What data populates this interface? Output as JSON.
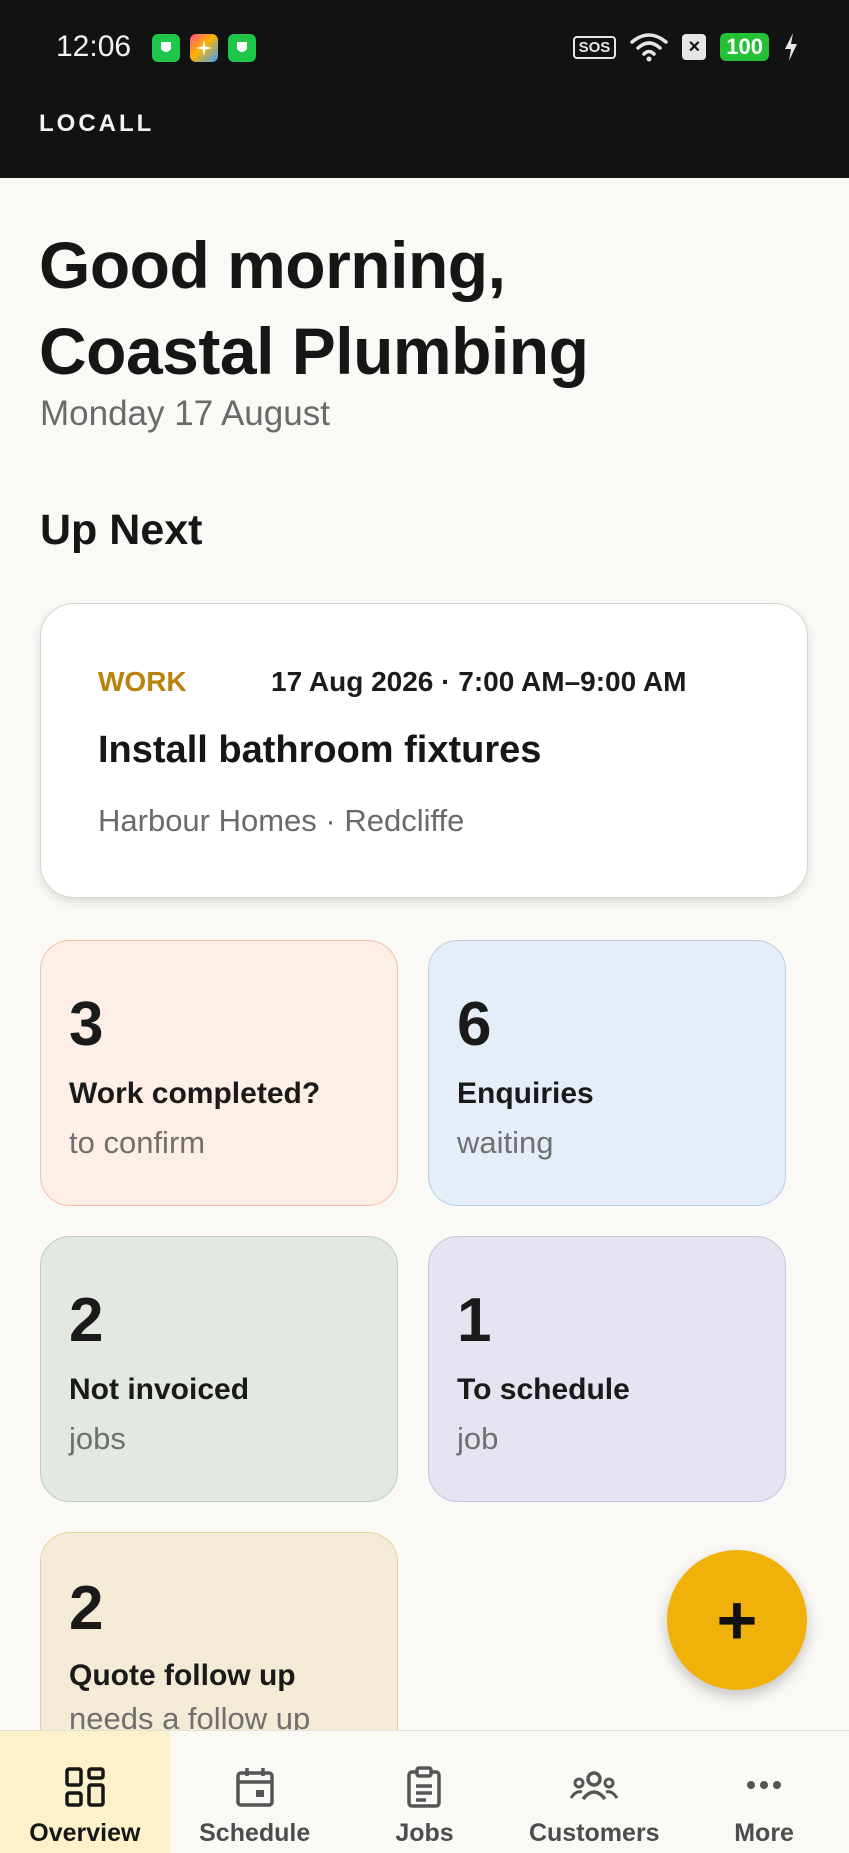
{
  "status_bar": {
    "time": "12:06",
    "sos": "SOS",
    "battery": "100"
  },
  "app": {
    "brand": "LOCALL"
  },
  "header": {
    "greeting_line1": "Good morning,",
    "greeting_line2": "Coastal Plumbing",
    "date": "Monday 17 August"
  },
  "up_next": {
    "section_title": "Up Next",
    "card": {
      "type": "WORK",
      "when": "17 Aug 2026 · 7:00 AM–9:00 AM",
      "title": "Install bathroom fixtures",
      "meta": "Harbour Homes · Redcliffe"
    }
  },
  "stats": [
    {
      "count": "3",
      "label": "Work completed?",
      "sub": "to confirm",
      "bg": "#fdeee6",
      "border": "#f2bfa8"
    },
    {
      "count": "6",
      "label": "Enquiries",
      "sub": "waiting",
      "bg": "#e5eef8",
      "border": "#b8cfe8"
    },
    {
      "count": "2",
      "label": "Not invoiced",
      "sub": "jobs",
      "bg": "#e3e8e1",
      "border": "#bfcfbd"
    },
    {
      "count": "1",
      "label": "To schedule",
      "sub": "job",
      "bg": "#e7e3f0",
      "border": "#cbc2e0"
    },
    {
      "count": "2",
      "label": "Quote follow up",
      "sub": "needs a follow up",
      "bg": "#f4ebd6",
      "border": "#e9d29a"
    }
  ],
  "fab": {
    "icon": "plus-icon",
    "label": "+"
  },
  "nav": {
    "items": [
      {
        "label": "Overview",
        "icon": "grid-icon",
        "active": true
      },
      {
        "label": "Schedule",
        "icon": "calendar-icon",
        "active": false
      },
      {
        "label": "Jobs",
        "icon": "clipboard-icon",
        "active": false
      },
      {
        "label": "Customers",
        "icon": "people-icon",
        "active": false
      },
      {
        "label": "More",
        "icon": "more-dots-icon",
        "active": false
      }
    ]
  },
  "colors": {
    "accent": "#f0b10b",
    "work_tag": "#b9820b",
    "status_bar": "#121212"
  }
}
